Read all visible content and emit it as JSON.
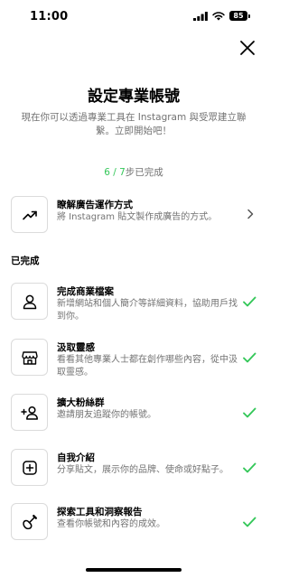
{
  "status": {
    "time": "11:00",
    "battery": "85"
  },
  "title": "設定專業帳號",
  "description": "現在你可以透過專業工具在 Instagram 與受眾建立聯繫。立即開始吧！",
  "progress": {
    "current": "6",
    "separator": " / ",
    "total": "7",
    "suffix": "步已完成"
  },
  "pending_item": {
    "title": "瞭解廣告運作方式",
    "desc": "將 Instagram 貼文製作成廣告的方式。",
    "icon": "trending-up-icon"
  },
  "completed_section_label": "已完成",
  "completed_items": [
    {
      "title": "完成商業檔案",
      "desc": "新增網站和個人簡介等詳細資料，協助用戶找到你。",
      "icon": "person-icon"
    },
    {
      "title": "汲取靈感",
      "desc": "看看其他專業人士都在創作哪些內容，從中汲取靈感。",
      "icon": "shop-icon"
    },
    {
      "title": "擴大粉絲群",
      "desc": "邀請朋友追蹤你的帳號。",
      "icon": "add-person-icon"
    },
    {
      "title": "自我介紹",
      "desc": "分享貼文，展示你的品牌、使命或好點子。",
      "icon": "add-post-icon"
    },
    {
      "title": "探索工具和洞察報告",
      "desc": "查看你帳號和內容的成效。",
      "icon": "guitar-icon"
    }
  ],
  "colors": {
    "green": "#34c759",
    "secondary_text": "#737373",
    "border": "#dbdbdb"
  }
}
